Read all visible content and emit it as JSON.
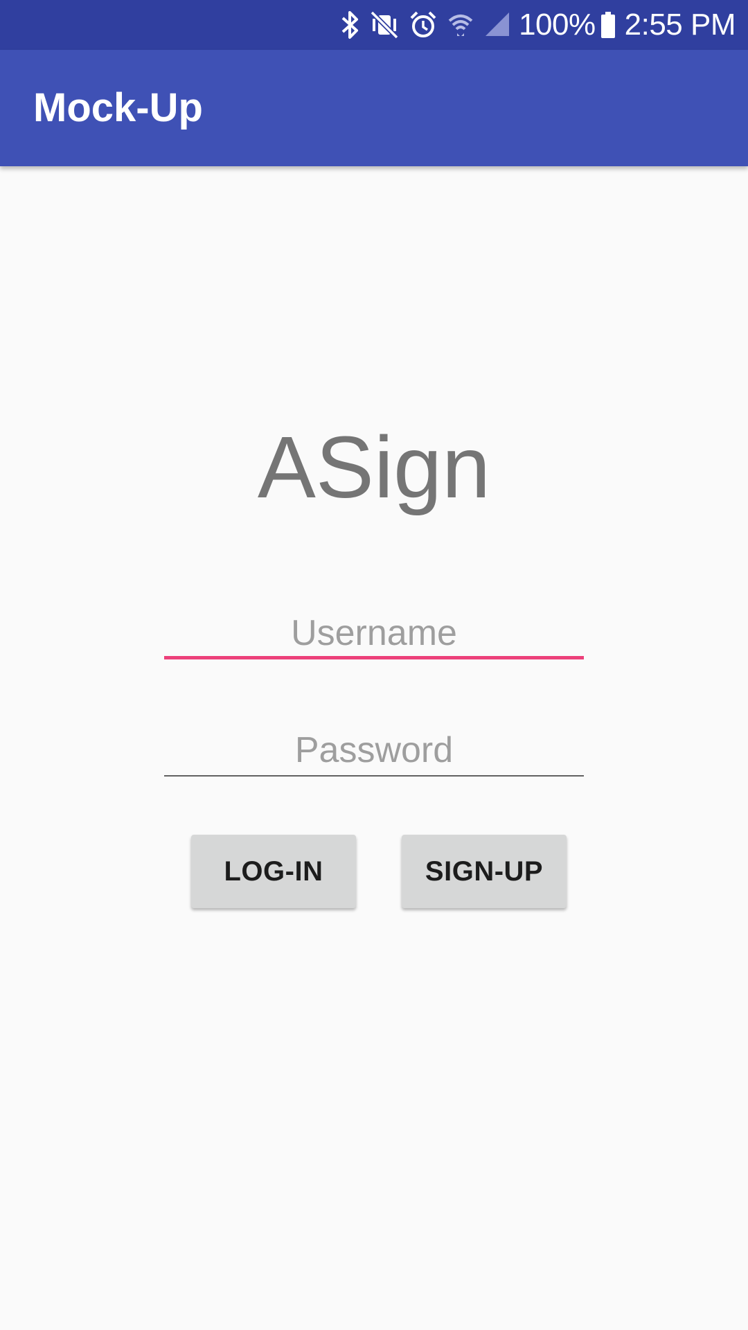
{
  "status_bar": {
    "battery_percent": "100%",
    "time": "2:55 PM",
    "icons": [
      "bluetooth-icon",
      "vibrate-mute-icon",
      "alarm-icon",
      "wifi-icon",
      "cell-signal-icon",
      "battery-icon"
    ],
    "color": "#303f9f"
  },
  "app_bar": {
    "title": "Mock-Up",
    "color": "#3f51b5"
  },
  "main": {
    "logo_text": "ASign",
    "username": {
      "value": "",
      "placeholder": "Username",
      "focused": true,
      "accent": "#ec407a"
    },
    "password": {
      "value": "",
      "placeholder": "Password"
    },
    "login_label": "LOG-IN",
    "signup_label": "SIGN-UP"
  }
}
